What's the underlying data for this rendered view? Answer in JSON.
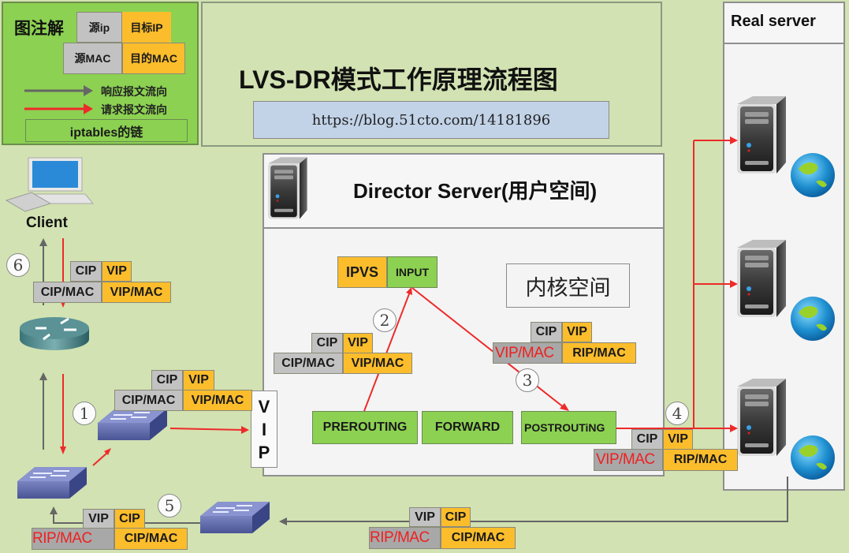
{
  "legend": {
    "title": "图注解",
    "src_ip": "源ip",
    "dst_ip": "目标IP",
    "src_mac": "源MAC",
    "dst_mac": "目的MAC",
    "response_flow": "响应报文流向",
    "request_flow": "请求报文流向",
    "chain": "iptables的链",
    "colors": {
      "source": "#c2c2c2",
      "destination": "#fbbd2c",
      "chain": "#8cd152",
      "response_arrow": "#666666",
      "request_arrow": "#ee2a2a"
    }
  },
  "title": {
    "heading": "LVS-DR模式工作原理流程图",
    "url": "https://blog.51cto.com/14181896"
  },
  "client": {
    "label": "Client"
  },
  "director": {
    "title": "Director  Server(用户空间)",
    "kernel_label": "内核空间",
    "ipvs": "IPVS",
    "chains": {
      "input": "INPUT",
      "prerouting": "PREROUTING",
      "forward": "FORWARD",
      "postrouting": "POSTROUTiNG"
    },
    "vip_label": [
      "V",
      "I",
      "P"
    ]
  },
  "real_server": {
    "title": "Real  server"
  },
  "steps": [
    "1",
    "2",
    "3",
    "4",
    "5",
    "6"
  ],
  "packets": {
    "p1": {
      "src_ip": "CIP",
      "dst_ip": "VIP",
      "src_mac": "CIP/MAC",
      "dst_mac": "VIP/MAC"
    },
    "p2": {
      "src_ip": "CIP",
      "dst_ip": "VIP",
      "src_mac": "CIP/MAC",
      "dst_mac": "VIP/MAC"
    },
    "p3": {
      "src_ip": "CIP",
      "dst_ip": "VIP",
      "src_mac": "VIP/MAC",
      "dst_mac": "RIP/MAC"
    },
    "p4": {
      "src_ip": "CIP",
      "dst_ip": "VIP",
      "src_mac": "VIP/MAC",
      "dst_mac": "RIP/MAC"
    },
    "p5a": {
      "src_ip": "VIP",
      "dst_ip": "CIP",
      "src_mac": "RIP/MAC",
      "dst_mac": "CIP/MAC"
    },
    "p5b": {
      "src_ip": "VIP",
      "dst_ip": "CIP",
      "src_mac": "RIP/MAC",
      "dst_mac": "CIP/MAC"
    },
    "p6": {
      "src_ip": "CIP",
      "dst_ip": "VIP",
      "src_mac": "CIP/MAC",
      "dst_mac": "VIP/MAC"
    }
  }
}
